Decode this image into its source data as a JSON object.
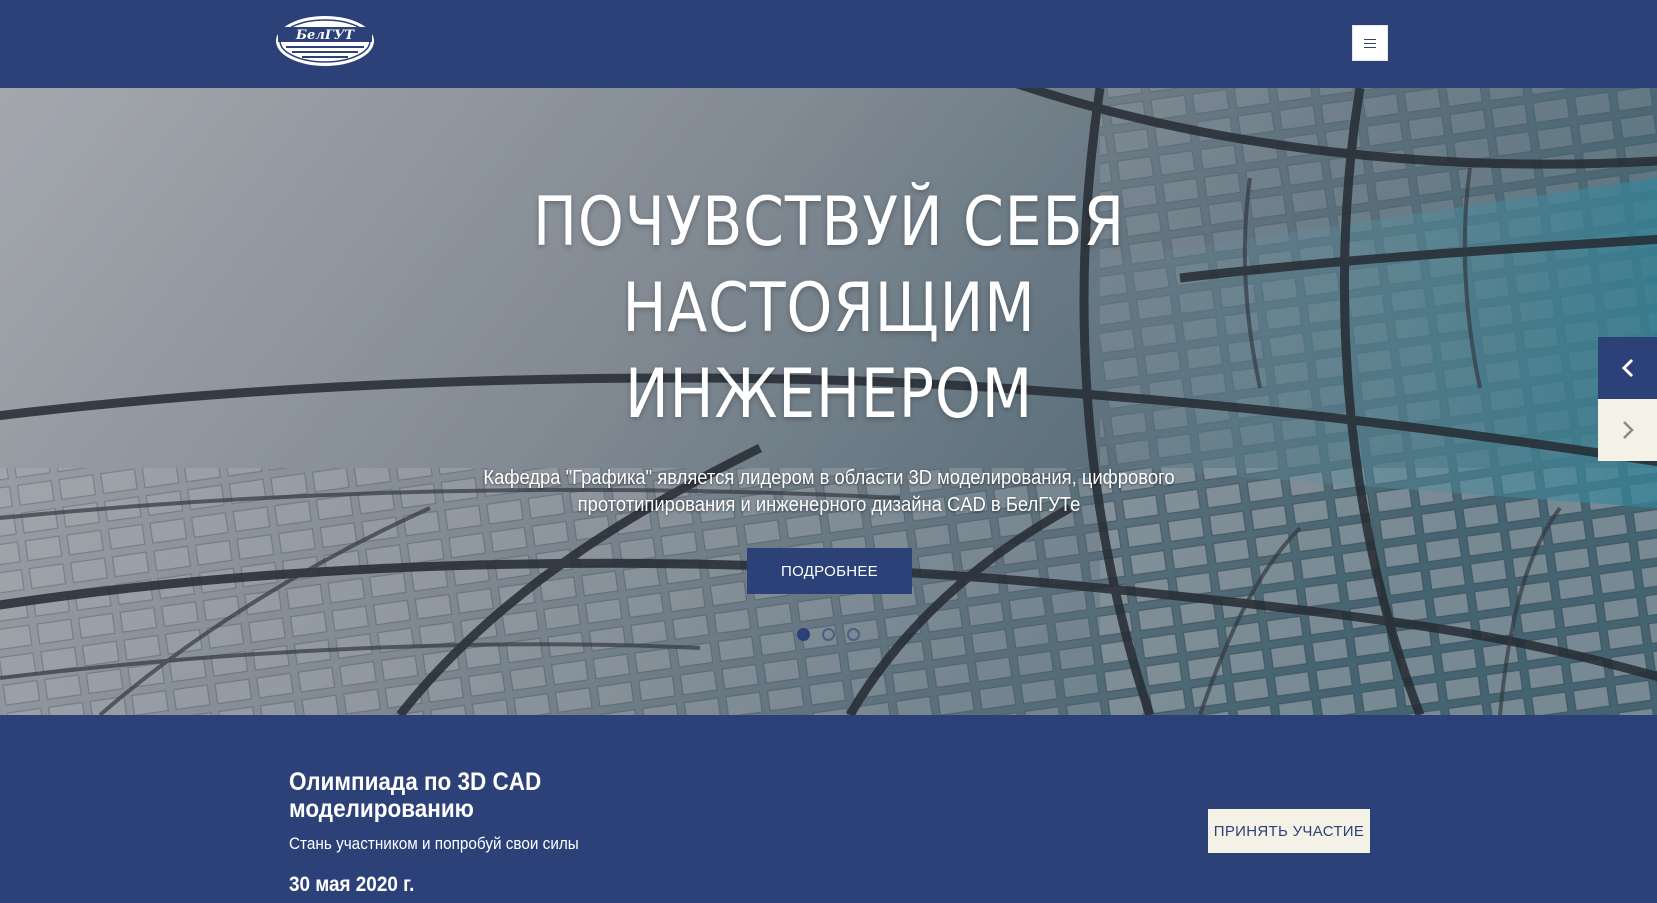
{
  "brand": {
    "logo_text": "БелГУТ",
    "color_primary": "#2d4179",
    "color_light": "#f4f1e6"
  },
  "header": {
    "menu_icon": "hamburger-menu-icon"
  },
  "hero": {
    "title_lines": [
      "ПОЧУВСТВУЙ СЕБЯ",
      "НАСТОЯЩИМ",
      "ИНЖЕНЕРОМ"
    ],
    "subtitle": "Кафедра \"Графика\" является лидером в области 3D моделирования, цифрового прототипирования и инженерного дизайна CAD в БелГУТе",
    "button_label": "ПОДРОБНЕЕ",
    "prev_icon": "chevron-left-icon",
    "next_icon": "chevron-right-icon",
    "slides_total": 3,
    "active_slide": 1
  },
  "promo": {
    "title": "Олимпиада по 3D CAD моделированию",
    "subtitle": "Стань участником и попробуй свои силы",
    "date": "30 мая 2020 г.",
    "button_label": "ПРИНЯТЬ УЧАСТИЕ"
  }
}
